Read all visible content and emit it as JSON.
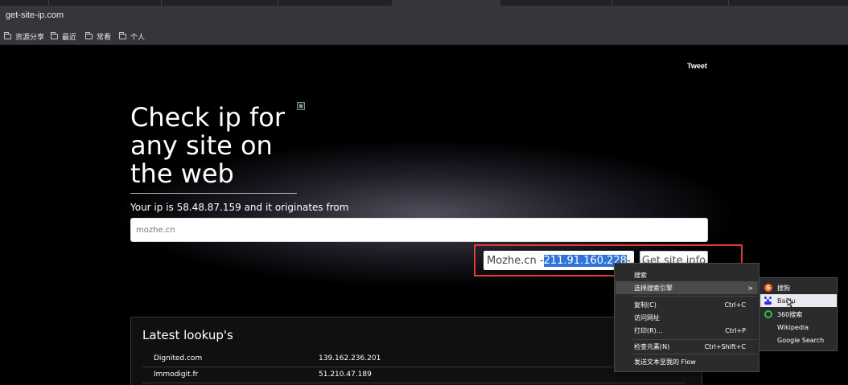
{
  "browser": {
    "url": "get-site-ip.com",
    "bookmarks": [
      "资源分享",
      "最近",
      "常看",
      "个人"
    ]
  },
  "page": {
    "tweet": "Tweet",
    "headline_lines": [
      "Check ip for",
      "any site on",
      "the web"
    ],
    "your_ip": "Your ip is 58.48.87.159 and it originates from",
    "site_input_value": "mozhe.cn",
    "result_prefix": "Mozhe.cn - ",
    "result_ip": "211.91.160.228",
    "result_suffix": " -",
    "get_button": "Get site info",
    "lookups_title": "Latest lookup's",
    "lookups": [
      {
        "name": "Dignited.com",
        "ip": "139.162.236.201"
      },
      {
        "name": "Immodigit.fr",
        "ip": "51.210.47.189"
      }
    ]
  },
  "context_menu": {
    "items": [
      {
        "label": "搜索",
        "shortcut": ""
      },
      {
        "label": "选择搜索引擎",
        "shortcut": "",
        "submenu": true
      },
      {
        "label": "复制(C)",
        "shortcut": "Ctrl+C"
      },
      {
        "label": "访问网址",
        "shortcut": ""
      },
      {
        "label": "打印(R)...",
        "shortcut": "Ctrl+P"
      },
      {
        "label": "检查元素(N)",
        "shortcut": "Ctrl+Shift+C"
      },
      {
        "label": "发送文本至我的 Flow",
        "shortcut": ""
      }
    ],
    "submenu_arrow": ">",
    "engines": [
      "搜狗",
      "Baidu",
      "360搜索",
      "Wikipedia",
      "Google Search"
    ]
  },
  "colors": {
    "highlight": "#2f74d8",
    "red_box": "#e53935",
    "menu_bg": "#2b2b2b"
  }
}
